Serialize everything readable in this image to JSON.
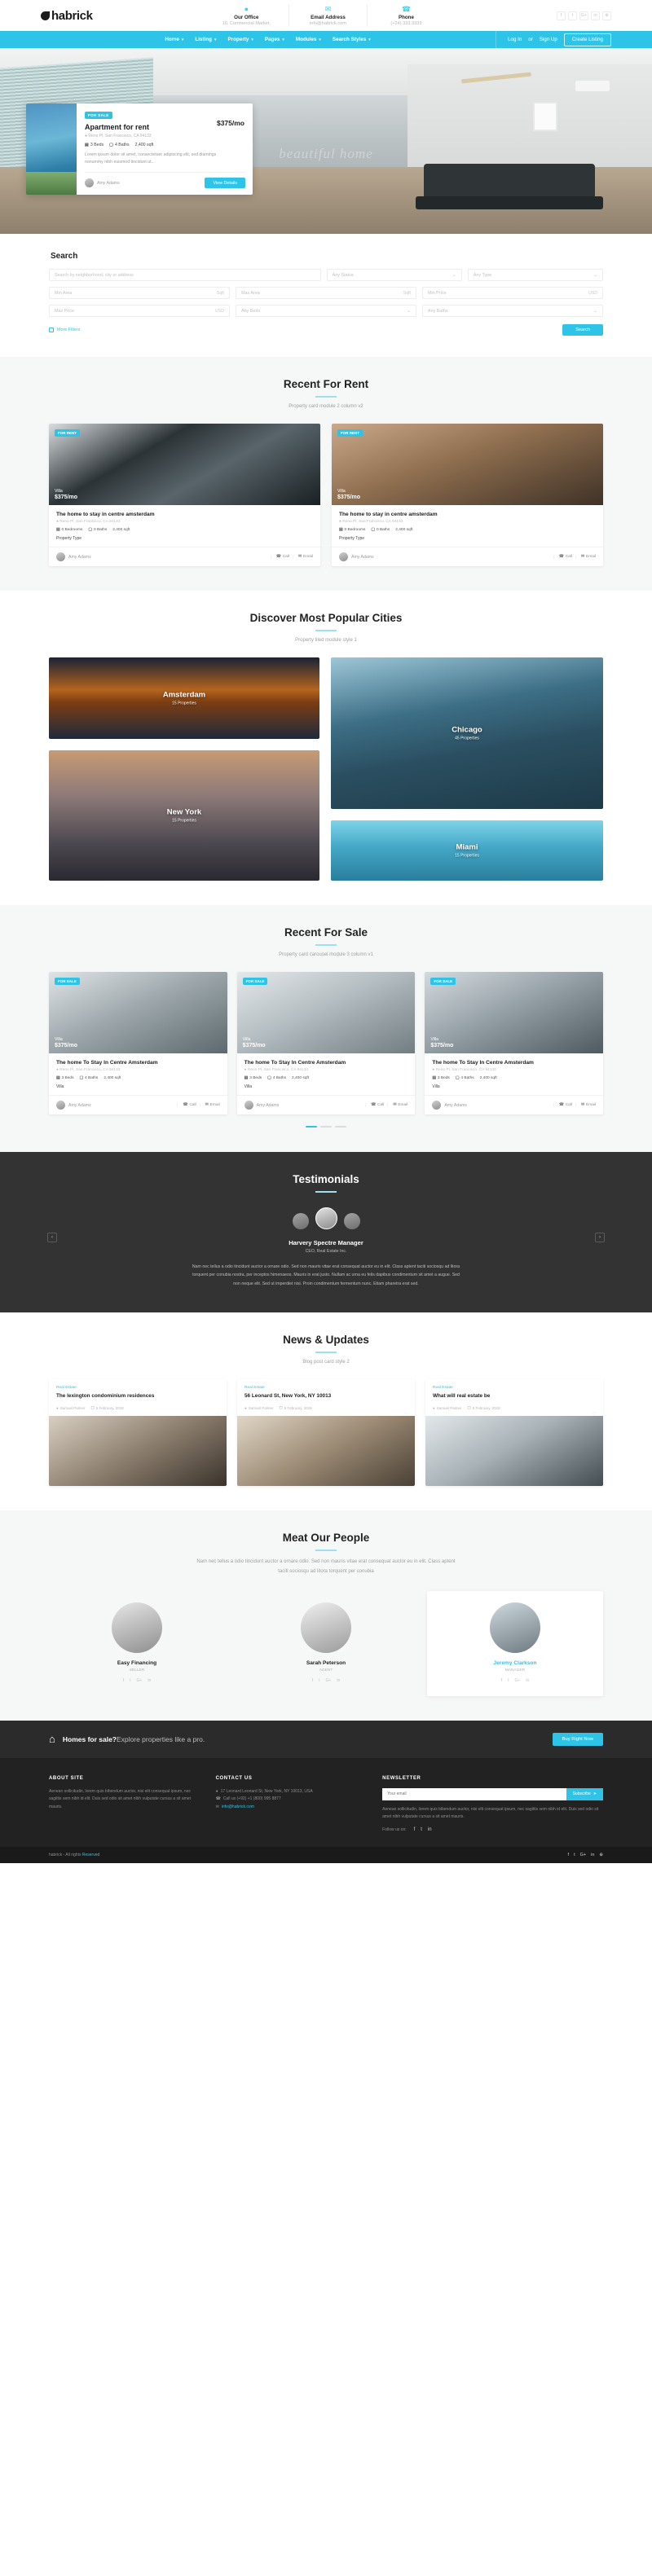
{
  "brand": {
    "name": "habrick",
    "accent": "#2ec4e8"
  },
  "topbar": {
    "info": [
      {
        "icon": "map-pin-icon",
        "label": "Our Office",
        "value": "10, Commercial Market,"
      },
      {
        "icon": "envelope-icon",
        "label": "Email Address",
        "value": "info@habrick.com"
      },
      {
        "icon": "phone-icon",
        "label": "Phone",
        "value": "(+24) 333 3333"
      }
    ],
    "socials": [
      "f",
      "t",
      "G+",
      "in",
      "⊕"
    ]
  },
  "nav": {
    "items": [
      "Home",
      "Listing",
      "Property",
      "Pages",
      "Modules",
      "Search Styles"
    ],
    "login": "Log In",
    "or": "or",
    "signup": "Sign Up",
    "create": "Create Listing"
  },
  "hero": {
    "watermark": "beautiful home",
    "card": {
      "badge": "FOR SALE",
      "title": "Apartment for rent",
      "price": "$375/mo",
      "address": "Reno Pl, San Francisco, CA 94133",
      "beds": "3 Beds",
      "baths": "4 Baths",
      "area": "2,400 sqft",
      "desc": "Lorem ipsum dolor sit amet, consectetuer adipiscing elit, sed diamings nonummy nibh euismod tincidunt ut...",
      "agent": "Amy Adams",
      "view": "View Details"
    }
  },
  "search": {
    "title": "Search",
    "keyword_placeholder": "Search by neighborhood, city or address",
    "status": "Any Status",
    "type": "Any Type",
    "min_area": "Min Area",
    "max_area": "Max Area",
    "sqft": "Sqft",
    "min_price": "Min Price",
    "max_price": "Max Price",
    "usd": "USD",
    "beds": "Any Beds",
    "baths": "Any Baths",
    "more_filters": "More Filters",
    "submit": "Search"
  },
  "rent": {
    "title": "Recent For Rent",
    "subtitle": "Property card module 2 column v2",
    "cards": [
      {
        "badge": "FOR RENT",
        "type": "Villa",
        "price": "$375/mo",
        "title": "The home to stay in centre amsterdam",
        "address": "Reno Pl, San Francisco, CA 94133",
        "beds": "0 Bedrooms",
        "baths": "0 Baths",
        "area": "2,400 sqft",
        "ptype": "Property Type",
        "agent": "Amy Adams",
        "call": "Call",
        "email": "Email",
        "img": "img-kitchen"
      },
      {
        "badge": "FOR RENT",
        "type": "Villa",
        "price": "$375/mo",
        "title": "The home to stay in centre amsterdam",
        "address": "Reno Pl, San Francisco, CA 94133",
        "beds": "0 Bedrooms",
        "baths": "0 Baths",
        "area": "2,400 sqft",
        "ptype": "Property Type",
        "agent": "Amy Adams",
        "call": "Call",
        "email": "Email",
        "img": "img-arch"
      }
    ]
  },
  "cities": {
    "title": "Discover Most Popular Cities",
    "subtitle": "Property tiled module style 1",
    "items": [
      {
        "name": "Amsterdam",
        "count": "15 Properties",
        "cls": "c-ams"
      },
      {
        "name": "Chicago",
        "count": "45 Properties",
        "cls": "c-chi"
      },
      {
        "name": "New York",
        "count": "15 Properties",
        "cls": "c-ny"
      },
      {
        "name": "Miami",
        "count": "15 Properties",
        "cls": "c-mia"
      }
    ]
  },
  "sale": {
    "title": "Recent For Sale",
    "subtitle": "Property card carousel module 3 column v1",
    "cards": [
      {
        "badge": "FOR SALE",
        "type": "Villa",
        "price": "$375/mo",
        "title": "The home To Stay In Centre Amsterdam",
        "address": "Reno Pl, San Francisco, CA 94133",
        "beds": "3 Beds",
        "baths": "4 Baths",
        "area": "2,400 sqft",
        "ptype": "Villa",
        "agent": "Amy Adams",
        "call": "Call",
        "email": "Email",
        "img": "img-room1"
      },
      {
        "badge": "FOR SALE",
        "type": "Villa",
        "price": "$375/mo",
        "title": "The home To Stay In Centre Amsterdam",
        "address": "Reno Pl, San Francisco, CA 94133",
        "beds": "3 Beds",
        "baths": "4 Baths",
        "area": "2,400 sqft",
        "ptype": "Villa",
        "agent": "Amy Adams",
        "call": "Call",
        "email": "Email",
        "img": "img-room2"
      },
      {
        "badge": "FOR SALE",
        "type": "Villa",
        "price": "$375/mo",
        "title": "The home To Stay In Centre Amsterdam",
        "address": "Reno Pl, San Francisco, CA 94133",
        "beds": "3 Beds",
        "baths": "4 Baths",
        "area": "2,400 sqft",
        "ptype": "Villa",
        "agent": "Amy Adams",
        "call": "Call",
        "email": "Email",
        "img": "img-room3"
      }
    ]
  },
  "testimonials": {
    "title": "Testimonials",
    "name": "Harvery Spectre Manager",
    "role": "CEO, Real Estate Inc.",
    "text": "Nam nec tellus a odio tincidunt auctor a ornare odio. Sed non mauris vitae erat consequat auctor eu in elit. Class aptent taciti sociosqu ad litora torquent per conubia nostra, per inceptos himenaeos. Mauris in erat justo. Nullam ac urna eu felis dapibus condimentum sit amet a augue. Sed non neque elit. Sed ut imperdiet nisi. Proin condimentum fermentum nunc. Etiam pharetra erat sed.",
    "prev": "‹",
    "next": "›"
  },
  "news": {
    "title": "News & Updates",
    "subtitle": "Blog post card style 2",
    "posts": [
      {
        "cat": "Real Estate",
        "title": "The lexington condominium residences",
        "author": "Samuel Palmer",
        "date": "5 February, 2018",
        "img": "img-bed"
      },
      {
        "cat": "Real Estate",
        "title": "56 Leonard St, New York, NY 10013",
        "author": "Samuel Palmer",
        "date": "5 February, 2018",
        "img": "img-dine"
      },
      {
        "cat": "Real Estate",
        "title": "What will real estate be",
        "author": "Samuel Palmer",
        "date": "5 February, 2018",
        "img": "img-kit2"
      }
    ]
  },
  "people": {
    "title": "Meat Our People",
    "subtitle": "Nam nec tellus a odio tincidunt auctor a ornare odio. Sed non mauris vitae erat consequat auctor eu in elit. Class aptent taciti sociosqu ad litora torquent per conubia",
    "members": [
      {
        "name": "Easy Financing",
        "role": "SELLER",
        "active": false
      },
      {
        "name": "Sarah Peterson",
        "role": "AGENT",
        "active": false
      },
      {
        "name": "Jeremy Clarkson",
        "role": "MANAGER",
        "active": true
      }
    ],
    "socials": [
      "f",
      "t",
      "G+",
      "in"
    ]
  },
  "cta": {
    "icon": "house-icon",
    "strong": "Homes for sale?",
    "light": "Explore properties like a pro.",
    "button": "Buy Right Now"
  },
  "footer": {
    "about": {
      "heading": "ABOUT SITE",
      "text": "Aenean sollicitudin, lorem quis bibendum auctor, nisi elit consequat ipsum, nec sagittis sem nibh id elit. Duis sed odio sit amet nibh vulputate cursus a sit amet mauris."
    },
    "contact": {
      "heading": "CONTACT US",
      "address": "17 Leonard Leonard St, New York, NY 10013, USA",
      "phone": "Call us (+92) +1 (800) 995 8877",
      "email": "info@habrick.com"
    },
    "newsletter": {
      "heading": "NEWSLETTER",
      "text": "Aenean sollicitudin, lorem quis bibendum auctor, nisi elit consequat ipsum, nec sagittis sem nibh id elit. Duis sed odio sit amet nibh vulputate cursus a sit amet mauris.",
      "placeholder": "Your email",
      "button": "Subscribe",
      "follow": "Follow us on:",
      "socials": [
        "f",
        "t",
        "in"
      ]
    }
  },
  "copyright": {
    "text": "habrick - All rights",
    "link": "Reserved",
    "socials": [
      "f",
      "t",
      "G+",
      "in",
      "⊕"
    ]
  }
}
